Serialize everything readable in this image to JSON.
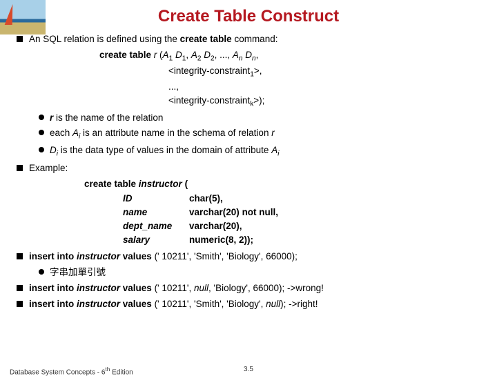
{
  "title": "Create Table Construct",
  "p1_a": "An SQL relation is defined using the ",
  "p1_b": "create table ",
  "p1_c": "command:",
  "syntax": {
    "l1a": "create table ",
    "l1b": "r ",
    "l1c": "(A",
    "l1d": " D",
    "l1e": ", A",
    "l1f": " D",
    "l1g": ", ..., A",
    "l1h": " D",
    "l1i": ",",
    "l2": "<integrity-constraint",
    "l2b": ">,",
    "l3": "...,",
    "l4": "<integrity-constraint",
    "l4b": ">);"
  },
  "b1a": "r",
  "b1b": " is the name of the relation",
  "b2a": "each ",
  "b2b": "A",
  "b2c": " is an attribute name in the schema of relation ",
  "b2d": "r",
  "b3a": "D",
  "b3b": " is the data type of values in the domain of attribute ",
  "b3c": "A",
  "example_label": "Example:",
  "ex": {
    "l1": "create table ",
    "l1b": "instructor ",
    "l1c": "(",
    "l2": "ID",
    "l2b": "char",
    "l2c": "(5),",
    "l3": "name",
    "l3b": "varchar",
    "l3c": "(20) ",
    "l3d": "not null,",
    "l4": "dept_name",
    "l4b": "varchar",
    "l4c": "(20),",
    "l5": "salary",
    "l5b": "numeric",
    "l5c": "(8, 2));"
  },
  "ins1a": "insert into ",
  "ins1b": "instructor ",
  "ins1c": "values ",
  "ins1d": "(' 10211', 'Smith', 'Biology', 66000);",
  "sb1": "字串加單引號",
  "ins2a": "insert into ",
  "ins2b": "instructor ",
  "ins2c": "values ",
  "ins2d": "(' 10211', ",
  "ins2e": "null",
  "ins2f": ", 'Biology', 66000); ->wrong!",
  "ins3a": "insert into ",
  "ins3b": "instructor ",
  "ins3c": "values ",
  "ins3d": "(' 10211', 'Smith', 'Biology', ",
  "ins3e": "null",
  "ins3f": "); ->right!",
  "footer_left_a": "Database System Concepts - 6",
  "footer_left_b": "th",
  "footer_left_c": " Edition",
  "footer_center": "3.5",
  "sub1": "1",
  "sub2": "2",
  "subn": "n",
  "subi": "i",
  "subk": "k"
}
